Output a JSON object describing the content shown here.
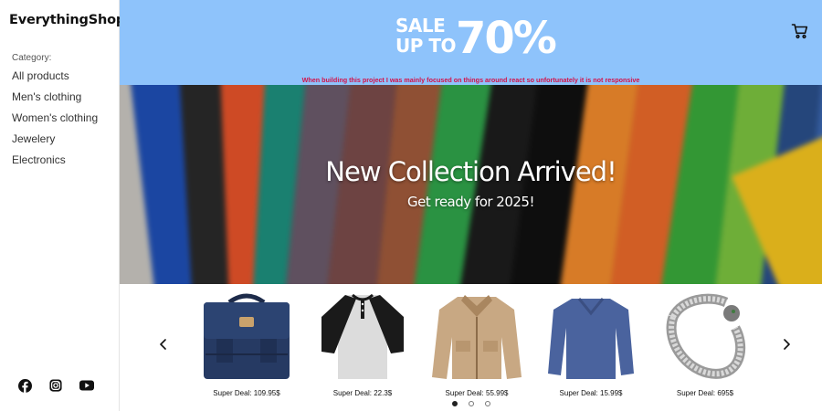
{
  "brand": "EverythingShop",
  "sidebar": {
    "category_label": "Category:",
    "items": [
      "All products",
      "Men's clothing",
      "Women's clothing",
      "Jewelery",
      "Electronics"
    ],
    "socials": [
      "facebook-icon",
      "instagram-icon",
      "youtube-icon"
    ]
  },
  "banner": {
    "sale": "SALE",
    "up_to": "UP TO",
    "percent": "70%",
    "notice": "When building this project I was mainly focused on things around react so unfortunately it is not responsive",
    "background": "#8ec3fb",
    "notice_color": "#d3124a"
  },
  "hero": {
    "title": "New Collection Arrived!",
    "subtitle": "Get ready for 2025!"
  },
  "carousel": {
    "products": [
      {
        "icon": "backpack-image",
        "price": "Super Deal: 109.95$"
      },
      {
        "icon": "raglan-tshirt-image",
        "price": "Super Deal: 22.3$"
      },
      {
        "icon": "jacket-image",
        "price": "Super Deal: 55.99$"
      },
      {
        "icon": "longsleeve-shirt-image",
        "price": "Super Deal: 15.99$"
      },
      {
        "icon": "bracelet-image",
        "price": "Super Deal: 695$"
      }
    ],
    "page_count": 3,
    "active_page": 1
  }
}
